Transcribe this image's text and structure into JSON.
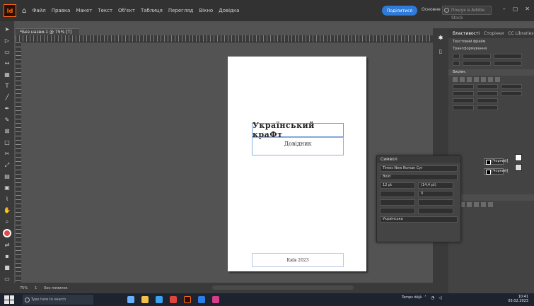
{
  "app": {
    "logo_text": "Id",
    "home_icon": "home-icon",
    "menu": [
      "Файл",
      "Правка",
      "Макет",
      "Текст",
      "Об'єкт",
      "Таблиця",
      "Перегляд",
      "Вікно",
      "Довідка"
    ],
    "share_label": "Поділитися",
    "workspace_label": "Основне",
    "search_placeholder": "Пошук в Adobe Stock"
  },
  "document": {
    "tab_label": "*Без назви-1 @ 75% [Т]",
    "title": "Український краФт",
    "subtitle": "Довідник",
    "footer": "Київ 2023"
  },
  "properties_panel": {
    "tabs": [
      "Властивості",
      "Сторінки",
      "CC Libraries"
    ],
    "section_text_frame": "Текстовий фрейм",
    "section_transform": "Трансформування",
    "align_header": "Вирівн."
  },
  "floating_panel": {
    "title": "Символ",
    "font_family": "Times New Roman Cyr",
    "font_style": "Bold",
    "size_label": "12 pt",
    "leading_label": "(14,4 pt)",
    "tracking_label": "0",
    "language": "Українська"
  },
  "fill_labels": [
    "[Чорний]",
    "[Чорний]"
  ],
  "statusbar": {
    "zoom": "75%",
    "page": "1",
    "status": "Без помилок"
  },
  "taskbar": {
    "search_placeholder": "Type here to search",
    "weather": "Temps déjà",
    "time": "10:41",
    "date": "03.02.2023"
  },
  "colors": {
    "accent": "#2f7bd9",
    "brand": "#ff6b1a",
    "toolbar_swatch": "#e24b4b"
  }
}
